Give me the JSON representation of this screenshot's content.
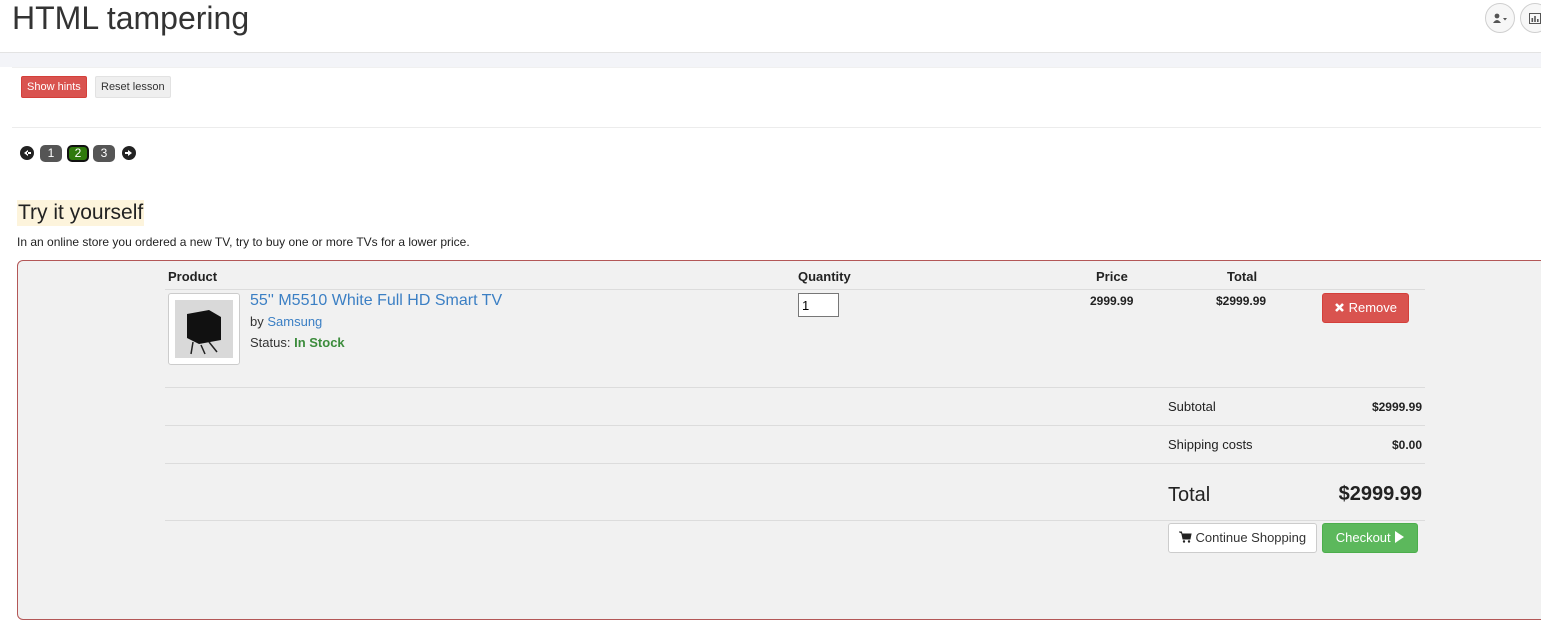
{
  "header": {
    "title": "HTML tampering"
  },
  "toolbar": {
    "show_hints": "Show hints",
    "reset_lesson": "Reset lesson"
  },
  "pager": {
    "pages": [
      "1",
      "2",
      "3"
    ],
    "current": "2"
  },
  "lesson": {
    "title": "Try it yourself",
    "intro": "In an online store you ordered a new TV, try to buy one or more TVs for a lower price."
  },
  "cart": {
    "columns": {
      "product": "Product",
      "quantity": "Quantity",
      "price": "Price",
      "total": "Total"
    },
    "item": {
      "name": "55'' M5510 White Full HD Smart TV",
      "by_label": "by",
      "brand": "Samsung",
      "status_label": "Status:",
      "status_value": "In Stock",
      "quantity": "1",
      "price": "2999.99",
      "total": "$2999.99",
      "remove_label": "Remove"
    },
    "summary": {
      "subtotal_label": "Subtotal",
      "subtotal_value": "$2999.99",
      "shipping_label": "Shipping costs",
      "shipping_value": "$0.00",
      "total_label": "Total",
      "total_value": "$2999.99"
    },
    "actions": {
      "continue_label": "Continue Shopping",
      "checkout_label": "Checkout"
    }
  },
  "icons": {
    "user": "user-icon",
    "chart": "bar-chart-icon",
    "prev": "arrow-left-icon",
    "next": "arrow-right-icon",
    "remove": "close-icon",
    "cart": "shopping-cart-icon",
    "checkout": "play-icon"
  },
  "colors": {
    "danger": "#d9534f",
    "success": "#5cb85c",
    "link": "#3b7fc4",
    "stock": "#3c8c3c",
    "active_page": "#2f7a0c"
  }
}
